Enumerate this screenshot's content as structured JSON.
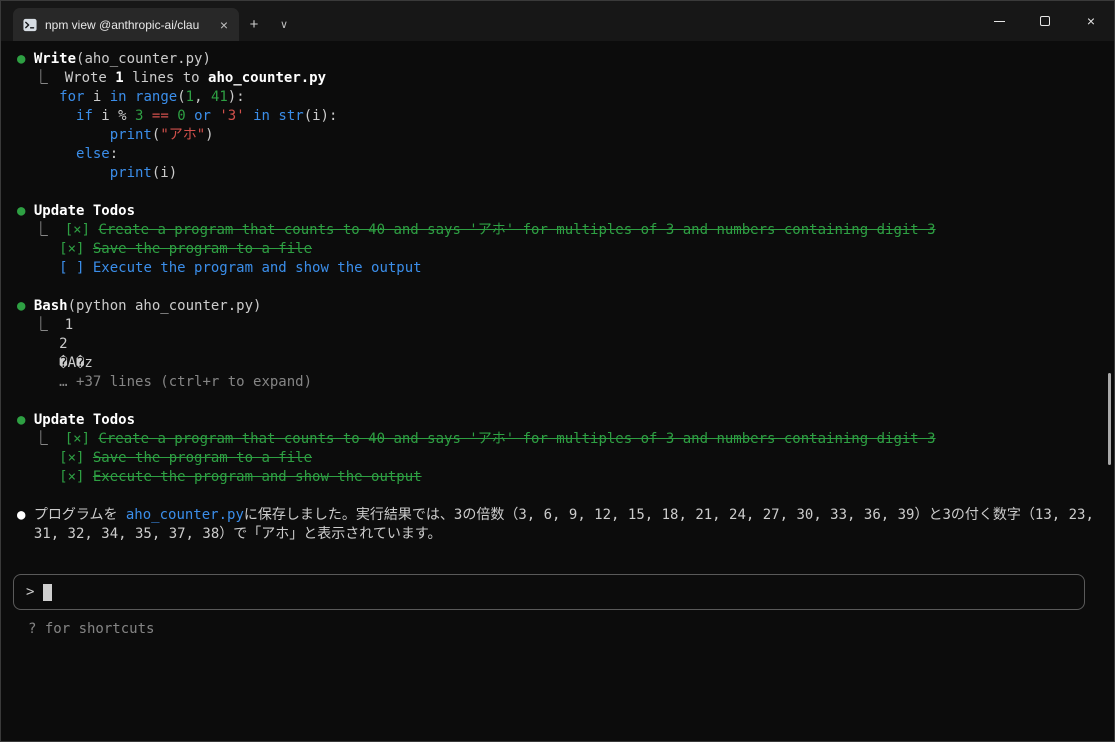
{
  "colors": {
    "term-bg": "#0c0c0c",
    "titlebar-bg": "#171717",
    "tab-bg": "#282828",
    "fg": "#cccccc",
    "bright": "#ffffff",
    "green": "#2ea043",
    "blue": "#3b8eea",
    "red": "#d1504b",
    "gray": "#858585",
    "box-border": "#5a5a5a"
  },
  "titlebar": {
    "tab_title": "npm view @anthropic-ai/clau",
    "tab_close_glyph": "×",
    "new_tab_glyph": "+",
    "dropdown_glyph": "∨",
    "close_glyph": "×"
  },
  "terminal": {
    "lines": [
      {
        "name": "tool-call-write",
        "seg": [
          {
            "t": "● ",
            "c": "green"
          },
          {
            "t": "Write",
            "c": "bold"
          },
          {
            "t": "(aho_counter.py)",
            "c": "fg"
          }
        ]
      },
      {
        "name": "tool-result",
        "seg": [
          {
            "t": "  ⎿  ",
            "c": "fg"
          },
          {
            "t": "Wrote ",
            "c": "fg"
          },
          {
            "t": "1",
            "c": "bold"
          },
          {
            "t": " lines to ",
            "c": "fg"
          },
          {
            "t": "aho_counter.py",
            "c": "bold"
          }
        ]
      },
      {
        "name": "code-line",
        "seg": [
          {
            "t": "     ",
            "c": "fg"
          },
          {
            "t": "for",
            "c": "blue"
          },
          {
            "t": " i ",
            "c": "fg"
          },
          {
            "t": "in",
            "c": "blue"
          },
          {
            "t": " ",
            "c": "fg"
          },
          {
            "t": "range",
            "c": "blue"
          },
          {
            "t": "(",
            "c": "fg"
          },
          {
            "t": "1",
            "c": "green"
          },
          {
            "t": ", ",
            "c": "fg"
          },
          {
            "t": "41",
            "c": "green"
          },
          {
            "t": "):",
            "c": "fg"
          }
        ]
      },
      {
        "name": "code-line",
        "seg": [
          {
            "t": "       ",
            "c": "fg"
          },
          {
            "t": "if",
            "c": "blue"
          },
          {
            "t": " i % ",
            "c": "fg"
          },
          {
            "t": "3",
            "c": "green"
          },
          {
            "t": " ",
            "c": "fg"
          },
          {
            "t": "==",
            "c": "red"
          },
          {
            "t": " ",
            "c": "fg"
          },
          {
            "t": "0",
            "c": "green"
          },
          {
            "t": " ",
            "c": "fg"
          },
          {
            "t": "or",
            "c": "blue"
          },
          {
            "t": " ",
            "c": "fg"
          },
          {
            "t": "'3'",
            "c": "red"
          },
          {
            "t": " ",
            "c": "fg"
          },
          {
            "t": "in",
            "c": "blue"
          },
          {
            "t": " ",
            "c": "fg"
          },
          {
            "t": "str",
            "c": "blue"
          },
          {
            "t": "(i):",
            "c": "fg"
          }
        ]
      },
      {
        "name": "code-line",
        "seg": [
          {
            "t": "           ",
            "c": "fg"
          },
          {
            "t": "print",
            "c": "blue"
          },
          {
            "t": "(",
            "c": "fg"
          },
          {
            "t": "\"アホ\"",
            "c": "red"
          },
          {
            "t": ")",
            "c": "fg"
          }
        ]
      },
      {
        "name": "code-line",
        "seg": [
          {
            "t": "       ",
            "c": "fg"
          },
          {
            "t": "else",
            "c": "blue"
          },
          {
            "t": ":",
            "c": "fg"
          }
        ]
      },
      {
        "name": "code-line",
        "seg": [
          {
            "t": "           ",
            "c": "fg"
          },
          {
            "t": "print",
            "c": "blue"
          },
          {
            "t": "(i)",
            "c": "fg"
          }
        ]
      },
      {
        "seg": []
      },
      {
        "name": "tool-call-update-todos",
        "seg": [
          {
            "t": "● ",
            "c": "green"
          },
          {
            "t": "Update Todos",
            "c": "bold"
          }
        ]
      },
      {
        "name": "todo-item-done",
        "seg": [
          {
            "t": "  ⎿  ",
            "c": "fg"
          },
          {
            "t": "[×] ",
            "c": "green"
          },
          {
            "t": "Create a program that counts to 40 and says 'アホ' for multiples of 3 and numbers containing digit 3",
            "c": "green strike"
          }
        ]
      },
      {
        "name": "todo-item-done",
        "seg": [
          {
            "t": "     ",
            "c": "fg"
          },
          {
            "t": "[×] ",
            "c": "green"
          },
          {
            "t": "Save the program to a file",
            "c": "green strike"
          }
        ]
      },
      {
        "name": "todo-item-pending",
        "seg": [
          {
            "t": "     ",
            "c": "fg"
          },
          {
            "t": "[ ] ",
            "c": "blue"
          },
          {
            "t": "Execute the program and show the output",
            "c": "blue"
          }
        ]
      },
      {
        "seg": []
      },
      {
        "name": "tool-call-bash",
        "seg": [
          {
            "t": "● ",
            "c": "green"
          },
          {
            "t": "Bash",
            "c": "bold"
          },
          {
            "t": "(python aho_counter.py)",
            "c": "fg"
          }
        ]
      },
      {
        "name": "bash-output",
        "seg": [
          {
            "t": "  ⎿  ",
            "c": "fg"
          },
          {
            "t": "1",
            "c": "fg"
          }
        ]
      },
      {
        "name": "bash-output",
        "seg": [
          {
            "t": "     2",
            "c": "fg"
          }
        ]
      },
      {
        "name": "bash-output",
        "seg": [
          {
            "t": "     �A�z",
            "c": "fg"
          }
        ]
      },
      {
        "name": "expand-hint",
        "seg": [
          {
            "t": "     ",
            "c": "fg"
          },
          {
            "t": "… +37 lines (ctrl+r to expand)",
            "c": "gray"
          }
        ]
      },
      {
        "seg": []
      },
      {
        "name": "tool-call-update-todos",
        "seg": [
          {
            "t": "● ",
            "c": "green"
          },
          {
            "t": "Update Todos",
            "c": "bold"
          }
        ]
      },
      {
        "name": "todo-item-done",
        "seg": [
          {
            "t": "  ⎿  ",
            "c": "fg"
          },
          {
            "t": "[×] ",
            "c": "green"
          },
          {
            "t": "Create a program that counts to 40 and says 'アホ' for multiples of 3 and numbers containing digit 3",
            "c": "green strike"
          }
        ]
      },
      {
        "name": "todo-item-done",
        "seg": [
          {
            "t": "     ",
            "c": "fg"
          },
          {
            "t": "[×] ",
            "c": "green"
          },
          {
            "t": "Save the program to a file",
            "c": "green strike"
          }
        ]
      },
      {
        "name": "todo-item-done",
        "seg": [
          {
            "t": "     ",
            "c": "fg"
          },
          {
            "t": "[×] ",
            "c": "green"
          },
          {
            "t": "Execute the program and show the output",
            "c": "green strike"
          }
        ]
      },
      {
        "seg": []
      },
      {
        "name": "assistant-message",
        "wrap": true,
        "seg": [
          {
            "t": "● ",
            "c": "bright"
          },
          {
            "t": "プログラムを ",
            "c": "fg"
          },
          {
            "t": "aho_counter.py",
            "c": "blue"
          },
          {
            "t": "に保存しました。実行結果では、3の倍数（3, 6, 9, 12, 15, 18, 21, 24, 27, 30, 33, 36, 39）と3の付く数字（13, 23, 31, 32, 34, 35, 37, 38）で「アホ」と表示されています。",
            "c": "fg"
          }
        ]
      }
    ]
  },
  "input": {
    "prompt": ">",
    "hint": "? for shortcuts"
  }
}
